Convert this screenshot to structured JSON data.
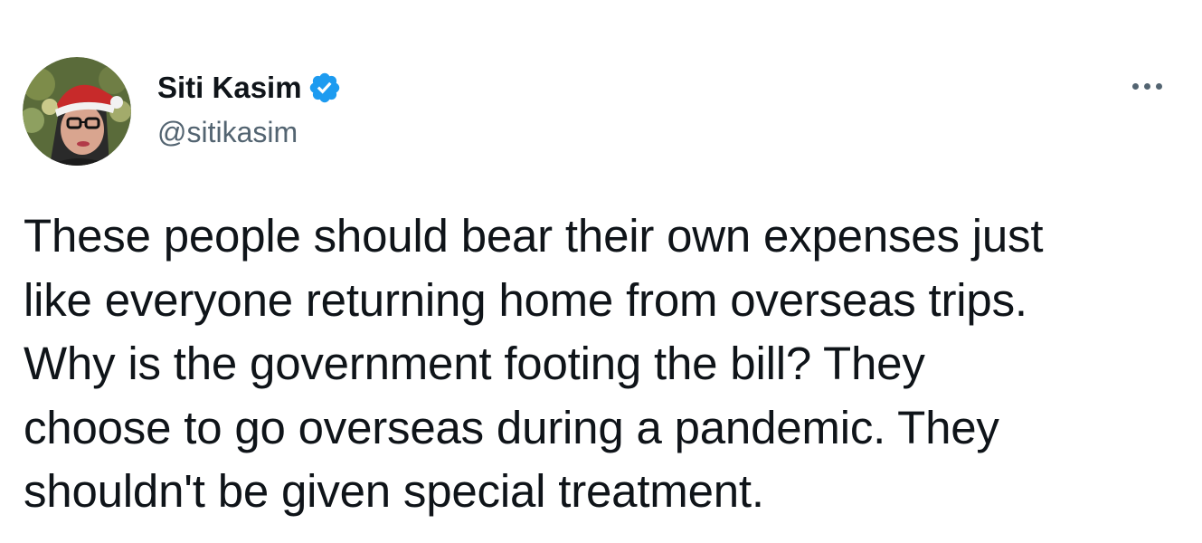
{
  "author": {
    "display_name": "Siti Kasim",
    "handle": "@sitikasim",
    "verified": true,
    "avatar_icon": "user-avatar-photo"
  },
  "tweet": {
    "text": "These people should bear their own expenses just\nlike everyone returning home from overseas trips.\nWhy is the government footing the bill? They\nchoose to go overseas during a pandemic. They\nshouldn't be given special treatment."
  },
  "icons": {
    "verified_badge": "verified-badge-icon",
    "more_menu": "more-options-icon"
  },
  "colors": {
    "text_primary": "#0f1419",
    "text_secondary": "#536471",
    "verified_blue": "#1d9bf0",
    "background": "#ffffff"
  }
}
